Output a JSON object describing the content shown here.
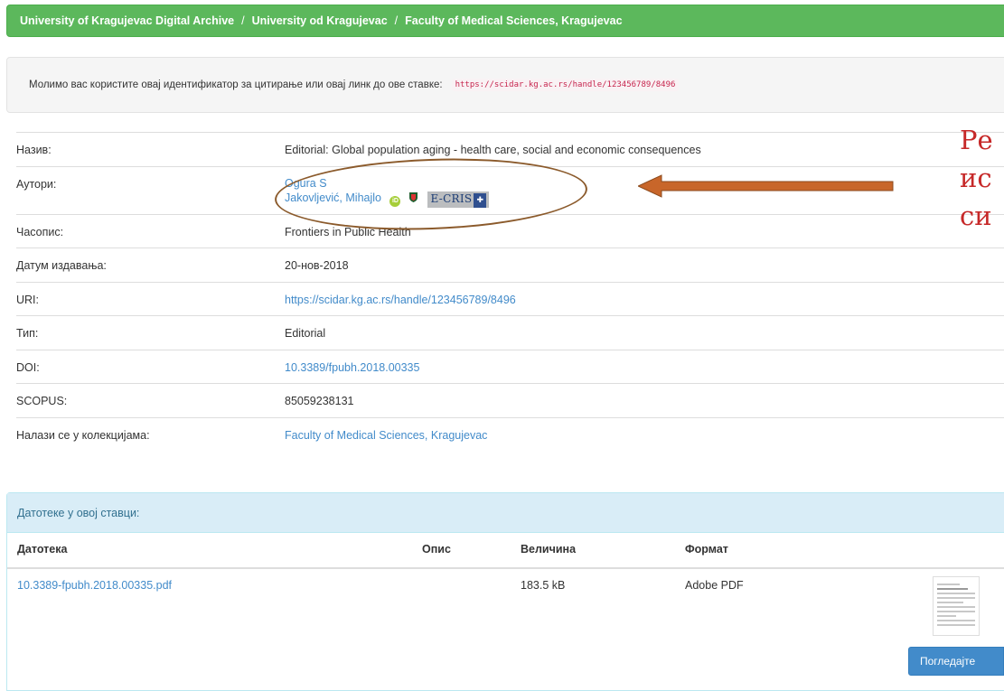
{
  "breadcrumb": {
    "items": [
      "University of Kragujevac Digital Archive",
      "University od Kragujevac",
      "Faculty of Medical Sciences, Kragujevac"
    ],
    "separator": "/"
  },
  "citation": {
    "text": "Молимо вас користите овај идентификатор за цитирање или овај линк до ове ставке:",
    "link": "https://scidar.kg.ac.rs/handle/123456789/8496"
  },
  "metadata": {
    "title_label": "Назив:",
    "title_value": "Editorial: Global population aging - health care, social and economic consequences",
    "authors_label": "Аутори:",
    "author_1": "Ogura S",
    "author_2": "Jakovljević, Mihajlo",
    "orcid_badge": "iD",
    "ecris_badge": "E-CRIS",
    "journal_label": "Часопис:",
    "journal_value": "Frontiers in Public Health",
    "date_label": "Датум издавања:",
    "date_value": "20-нов-2018",
    "uri_label": "URI:",
    "uri_value": "https://scidar.kg.ac.rs/handle/123456789/8496",
    "type_label": "Тип:",
    "type_value": "Editorial",
    "doi_label": "DOI:",
    "doi_value": "10.3389/fpubh.2018.00335",
    "scopus_label": "SCOPUS:",
    "scopus_value": "85059238131",
    "collections_label": "Налази се у колекцијама:",
    "collections_value": "Faculty of Medical Sciences, Kragujevac"
  },
  "annotation": {
    "side_text": [
      "Ре",
      "ис",
      "си"
    ],
    "color": "#c62828",
    "oval_color": "#8b5a2b"
  },
  "files": {
    "heading": "Датотеке у овој ставци:",
    "columns": [
      "Датотека",
      "Опис",
      "Величина",
      "Формат"
    ],
    "rows": [
      {
        "name": "10.3389-fpubh.2018.00335.pdf",
        "description": "",
        "size": "183.5 kB",
        "format": "Adobe PDF"
      }
    ],
    "view_button": "Погледајте"
  },
  "colors": {
    "breadcrumb_bg": "#5cb85c",
    "link": "#428bca",
    "panel_head_bg": "#d9edf7",
    "button_bg": "#428bca"
  }
}
